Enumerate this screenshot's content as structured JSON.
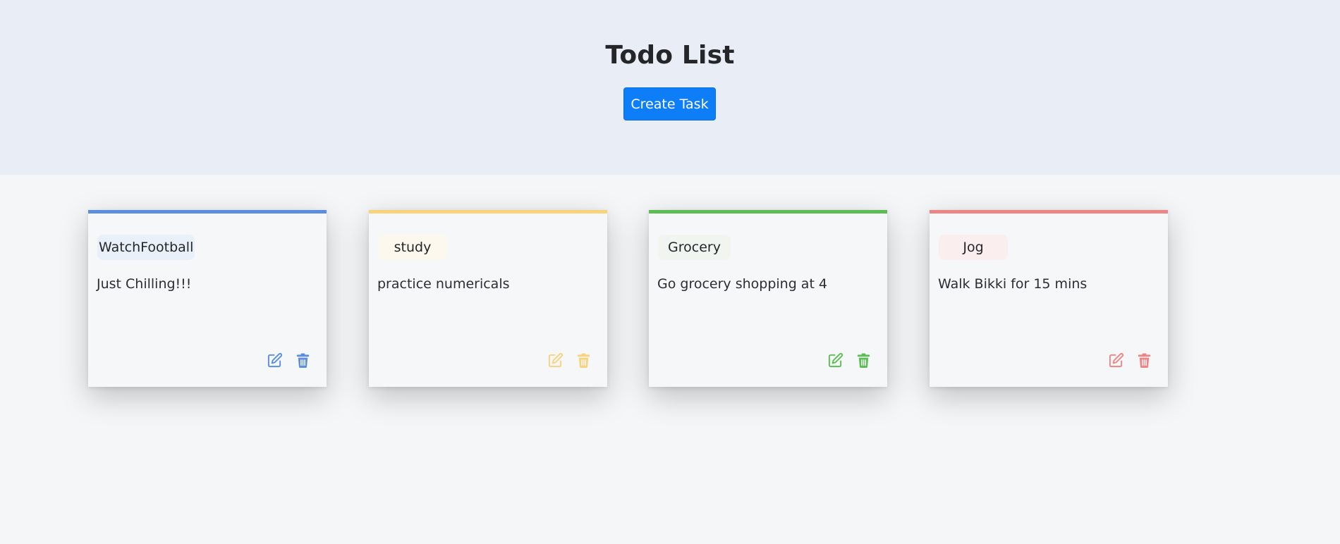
{
  "header": {
    "title": "Todo List",
    "create_button_label": "Create Task"
  },
  "tasks": [
    {
      "name": "WatchFootball",
      "description": "Just Chilling!!!",
      "accent_color": "#5b8edc",
      "chip_color": "#eaf0fa",
      "edit_icon": "edit-icon",
      "delete_icon": "trash-icon"
    },
    {
      "name": "study",
      "description": "practice numericals",
      "accent_color": "#f9d27c",
      "chip_color": "#fcf8ee",
      "edit_icon": "edit-icon",
      "delete_icon": "trash-icon"
    },
    {
      "name": "Grocery",
      "description": "Go grocery shopping at 4",
      "accent_color": "#5cbd55",
      "chip_color": "#f0f6ef",
      "edit_icon": "edit-icon",
      "delete_icon": "trash-icon"
    },
    {
      "name": "Jog",
      "description": "Walk Bikki for 15 mins",
      "accent_color": "#ec8585",
      "chip_color": "#fbeeee",
      "edit_icon": "edit-icon",
      "delete_icon": "trash-icon"
    }
  ]
}
